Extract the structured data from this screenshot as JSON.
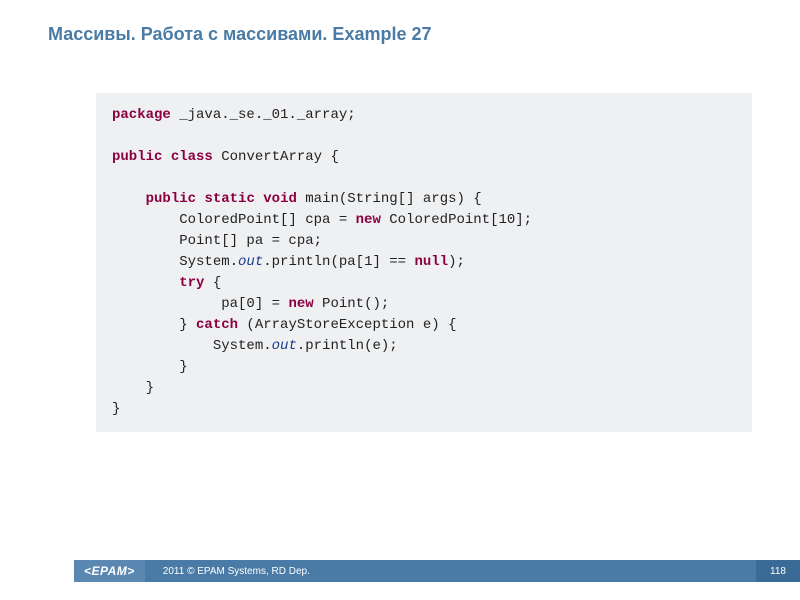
{
  "title": "Массивы. Работа с массивами. Example 27",
  "code": {
    "l1": {
      "kw1": "package",
      "rest": " _java._se._01._array;"
    },
    "l2": {
      "kw1": "public",
      "kw2": "class",
      "rest": " ConvertArray {"
    },
    "l3": {
      "indent": "    ",
      "kw1": "public",
      "kw2": "static",
      "kw3": "void",
      "rest": " main(String[] args) {"
    },
    "l4a": "        ColoredPoint[] cpa = ",
    "l4kw": "new",
    "l4b": " ColoredPoint[10];",
    "l5": "        Point[] pa = cpa;",
    "l6a": "        System.",
    "l6out": "out",
    "l6b": ".println(pa[1] == ",
    "l6kw": "null",
    "l6c": ");",
    "l7a": "        ",
    "l7kw": "try",
    "l7b": " {",
    "l8a": "             pa[0] = ",
    "l8kw": "new",
    "l8b": " Point();",
    "l9a": "        } ",
    "l9kw": "catch",
    "l9b": " (ArrayStoreException e) {",
    "l10a": "            System.",
    "l10out": "out",
    "l10b": ".println(e);",
    "l11": "        }",
    "l12": "    }",
    "l13": "}"
  },
  "footer": {
    "logo": "<EPAM>",
    "text": "2011 © EPAM Systems, RD Dep.",
    "page": "118"
  }
}
